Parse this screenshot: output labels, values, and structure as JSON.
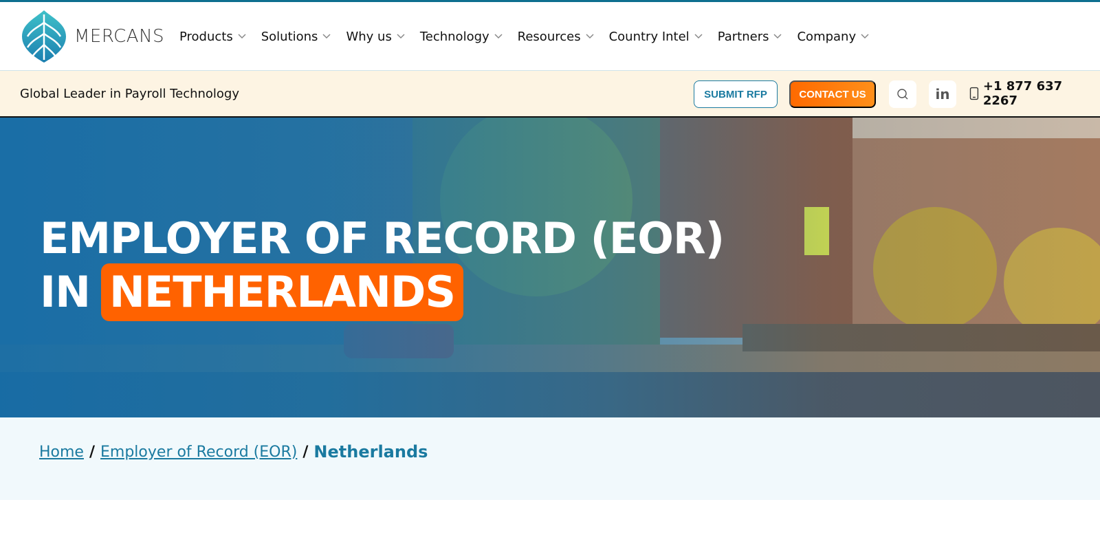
{
  "brand": {
    "name": "MERCANS",
    "accent_color": "#1a7aa0",
    "highlight_color": "#ff6200"
  },
  "nav": {
    "items": [
      {
        "label": "Products"
      },
      {
        "label": "Solutions"
      },
      {
        "label": "Why us"
      },
      {
        "label": "Technology"
      },
      {
        "label": "Resources"
      },
      {
        "label": "Country Intel"
      },
      {
        "label": "Partners"
      },
      {
        "label": "Company"
      }
    ]
  },
  "subbar": {
    "tagline": "Global Leader in Payroll Technology",
    "submit_rfp_label": "SUBMIT RFP",
    "contact_label": "CONTACT US",
    "linkedin_text": "in",
    "phone": "+1 877 637 2267"
  },
  "hero": {
    "line1": "EMPLOYER OF RECORD (EOR)",
    "line2_prefix": "IN",
    "line2_highlight": "NETHERLANDS"
  },
  "breadcrumb": {
    "home": "Home",
    "parent": "Employer of Record (EOR)",
    "separator": "/",
    "current": "Netherlands"
  }
}
